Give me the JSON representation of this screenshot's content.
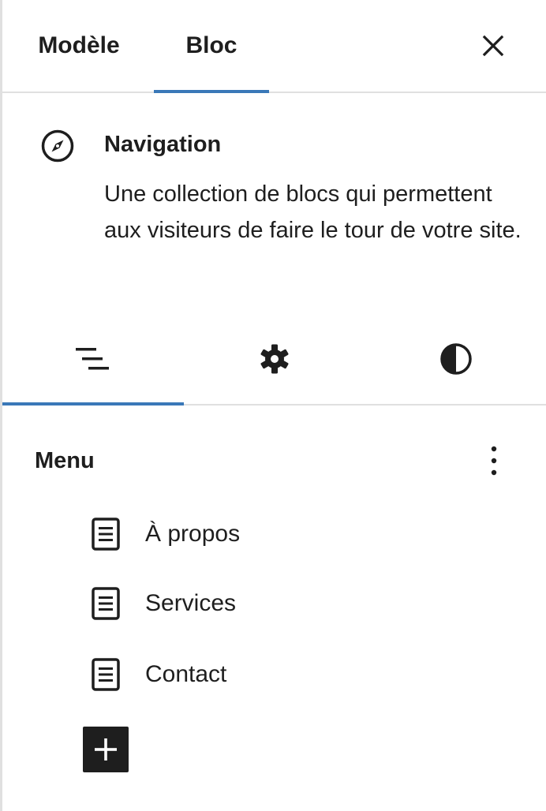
{
  "header": {
    "tabs": [
      {
        "label": "Modèle",
        "active": false
      },
      {
        "label": "Bloc",
        "active": true
      }
    ],
    "close_icon": "close-icon"
  },
  "block": {
    "icon": "compass-icon",
    "title": "Navigation",
    "description": "Une collection de blocs qui permettent aux visiteurs de faire le tour de votre site."
  },
  "inspector_tabs": [
    {
      "icon": "list-view-icon",
      "active": true
    },
    {
      "icon": "gear-icon",
      "active": false
    },
    {
      "icon": "contrast-icon",
      "active": false
    }
  ],
  "menu": {
    "title": "Menu",
    "more_icon": "more-vertical-icon",
    "items": [
      {
        "label": "À propos",
        "icon": "page-icon"
      },
      {
        "label": "Services",
        "icon": "page-icon"
      },
      {
        "label": "Contact",
        "icon": "page-icon"
      }
    ],
    "add_icon": "plus-icon"
  },
  "colors": {
    "accent": "#3a78b8",
    "text": "#1e1e1e",
    "divider": "#e0e0e0"
  }
}
